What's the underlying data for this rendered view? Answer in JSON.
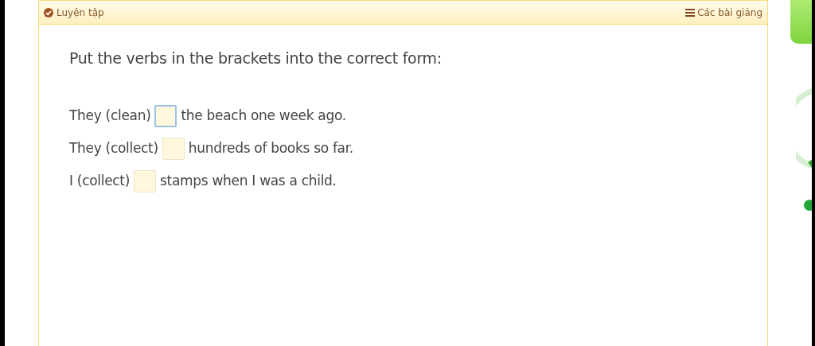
{
  "header": {
    "title": "Luyện tập",
    "lessons_link": "Các bài giảng"
  },
  "instruction": "Put the verbs in the brackets into the correct form:",
  "questions": [
    {
      "before": "They (clean)",
      "after": "the beach one week ago.",
      "focused": true
    },
    {
      "before": "They (collect)",
      "after": "hundreds of books so far.",
      "focused": false
    },
    {
      "before": "I (collect)",
      "after": "stamps when I was a child.",
      "focused": false
    }
  ]
}
